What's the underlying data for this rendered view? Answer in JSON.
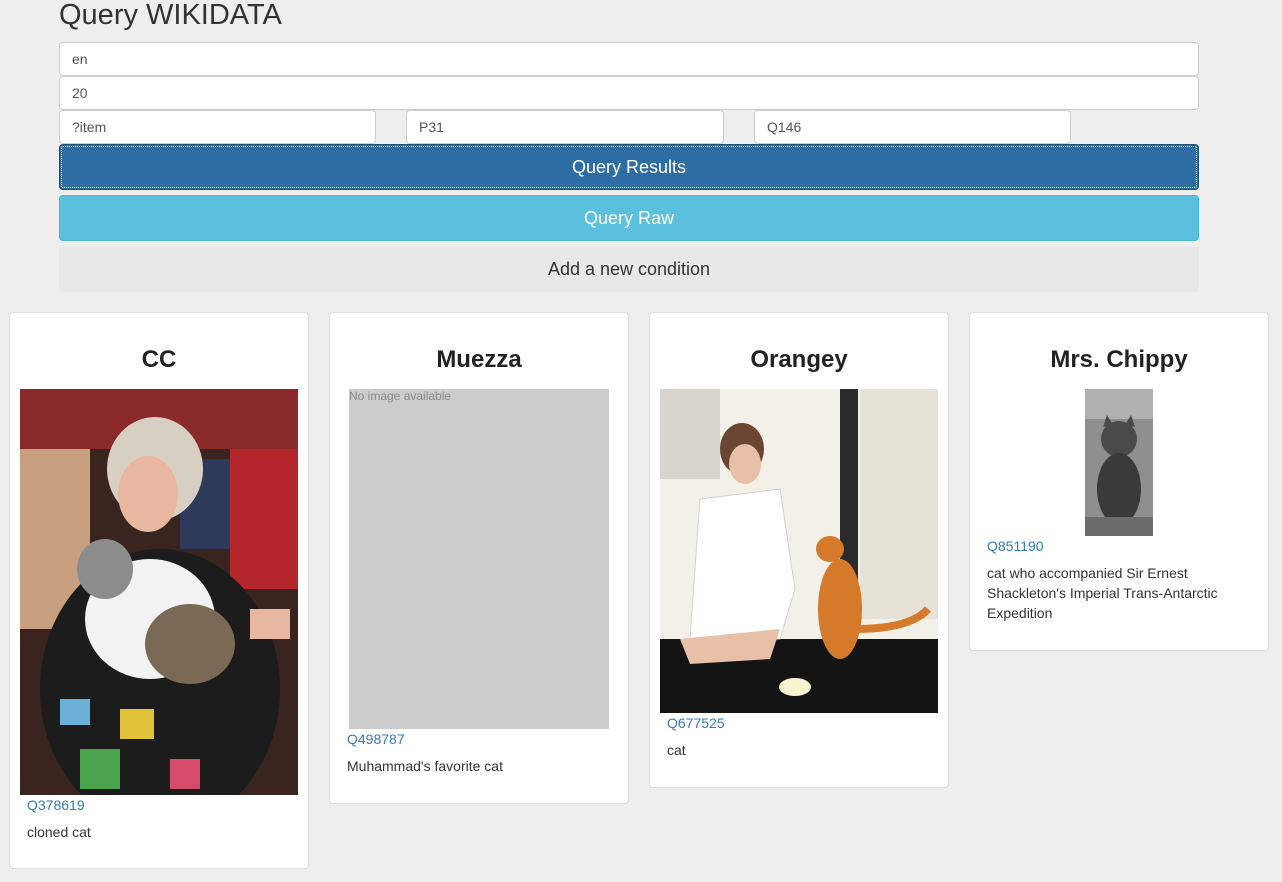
{
  "page": {
    "title": "Query WIKIDATA"
  },
  "form": {
    "language": "en",
    "limit": "20",
    "subject": "?item",
    "property": "P31",
    "value": "Q146",
    "query_results_label": "Query Results",
    "query_raw_label": "Query Raw",
    "add_condition_label": "Add a new condition"
  },
  "results": [
    {
      "name": "CC",
      "qid": "Q378619",
      "description": "cloned cat"
    },
    {
      "name": "Muezza",
      "qid": "Q498787",
      "description": "Muhammad's favorite cat",
      "image_placeholder": "No image available"
    },
    {
      "name": "Orangey",
      "qid": "Q677525",
      "description": "cat"
    },
    {
      "name": "Mrs. Chippy",
      "qid": "Q851190",
      "description": "cat who accompanied Sir Ernest Shackleton's Imperial Trans-Antarctic Expedition"
    }
  ]
}
